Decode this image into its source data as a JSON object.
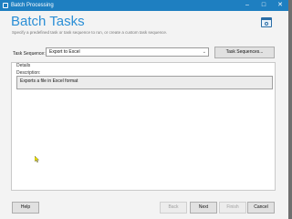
{
  "window": {
    "title": "Batch Processing",
    "controls": [
      "–",
      "□",
      "✕"
    ]
  },
  "header": {
    "title": "Batch Tasks",
    "subtitle": "Specify a predefined task or task sequence to run, or create a custom task sequence.",
    "icon": "batch-window-icon"
  },
  "task_sequence": {
    "label": "Task Sequence:",
    "selected": "Export to Excel",
    "button_label": "Task Sequences..."
  },
  "details": {
    "group_label": "Details",
    "description_label": "Description:",
    "description": "Exports a file in Excel format"
  },
  "footer": {
    "help": "Help",
    "back": "Back",
    "next": "Next",
    "finish": "Finish",
    "cancel": "Cancel"
  },
  "colors": {
    "title_bar": "#1e7fc1",
    "header_title": "#2b8fd6"
  }
}
